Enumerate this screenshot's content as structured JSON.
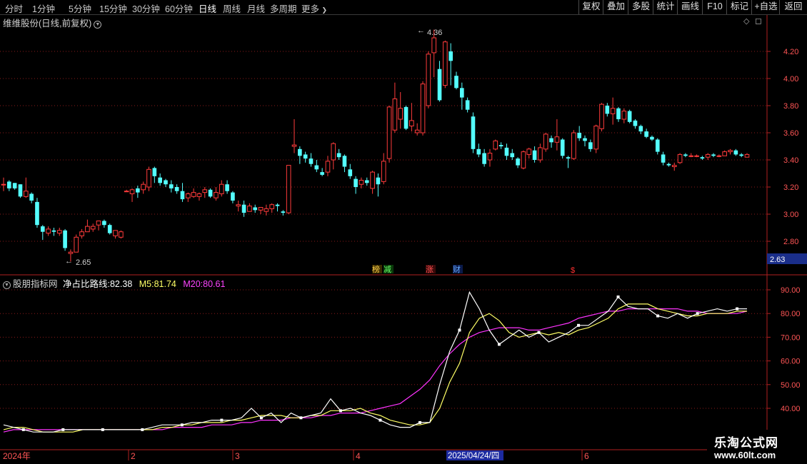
{
  "toolbar": {
    "periods": [
      "分时",
      "1分钟",
      "5分钟",
      "15分钟",
      "30分钟",
      "60分钟",
      "日线",
      "周线",
      "月线",
      "多周期",
      "更多"
    ],
    "more_glyph": "❯",
    "right_buttons": [
      "复权",
      "叠加",
      "多股",
      "统计",
      "画线",
      "F10",
      "标记",
      "+自选",
      "返回"
    ]
  },
  "main_panel": {
    "title": "维维股份(日线,前复权)",
    "y_ticks": [
      "4.20",
      "4.00",
      "3.80",
      "3.60",
      "3.40",
      "3.20",
      "3.00",
      "2.80"
    ],
    "price_tag": "2.63",
    "high_label": "4.36",
    "low_label": "2.65",
    "markers": [
      "榜",
      "减",
      "涨",
      "财",
      "$"
    ],
    "colors": {
      "up": "#ff3b3b",
      "down": "#54ffff",
      "grid": "#8a1a1a",
      "axis": "#b02020"
    }
  },
  "indicator_panel": {
    "name": "股朋指标网",
    "line_label": "净占比路线:",
    "line_value": "82.38",
    "m5_label": "M5:",
    "m5_value": "81.74",
    "m20_label": "M20:",
    "m20_value": "80.61",
    "y_ticks": [
      "90.00",
      "80.00",
      "70.00",
      "60.00",
      "50.00",
      "40.00"
    ],
    "colors": {
      "line": "#ffffff",
      "m5": "#ffff66",
      "m20": "#ff33ff"
    }
  },
  "date_axis": {
    "labels": [
      "2024年",
      "2",
      "3",
      "4",
      "6"
    ],
    "cursor_date": "2025/04/24/四"
  },
  "watermark": {
    "line1": "乐淘公式网",
    "line2": "www.60lt.com"
  },
  "chart_data": {
    "type": "candlestick",
    "candles": [
      [
        3.22,
        3.27,
        3.17,
        3.22
      ],
      [
        3.24,
        3.25,
        3.17,
        3.19
      ],
      [
        3.23,
        3.23,
        3.18,
        3.19
      ],
      [
        3.22,
        3.22,
        3.12,
        3.13
      ],
      [
        3.13,
        3.27,
        3.12,
        3.17
      ],
      [
        3.15,
        3.16,
        3.08,
        3.1
      ],
      [
        3.09,
        3.12,
        2.9,
        2.92
      ],
      [
        2.91,
        2.92,
        2.81,
        2.87
      ],
      [
        2.86,
        2.91,
        2.84,
        2.89
      ],
      [
        2.88,
        2.9,
        2.84,
        2.87
      ],
      [
        2.86,
        2.9,
        2.84,
        2.88
      ],
      [
        2.88,
        2.89,
        2.73,
        2.75
      ],
      [
        2.71,
        2.74,
        2.65,
        2.72
      ],
      [
        2.72,
        2.85,
        2.72,
        2.83
      ],
      [
        2.84,
        2.89,
        2.82,
        2.87
      ],
      [
        2.87,
        2.96,
        2.87,
        2.91
      ],
      [
        2.89,
        2.93,
        2.87,
        2.91
      ],
      [
        2.92,
        2.93,
        2.88,
        2.95
      ],
      [
        2.95,
        2.96,
        2.9,
        2.92
      ],
      [
        2.92,
        2.93,
        2.85,
        2.86
      ],
      [
        2.84,
        2.86,
        2.82,
        2.88
      ],
      [
        2.83,
        2.88,
        2.82,
        2.87
      ],
      [
        3.17,
        3.18,
        3.17,
        3.17
      ],
      [
        3.15,
        3.19,
        3.09,
        3.18
      ],
      [
        3.19,
        3.21,
        3.12,
        3.16
      ],
      [
        3.18,
        3.24,
        3.15,
        3.22
      ],
      [
        3.2,
        3.35,
        3.17,
        3.33
      ],
      [
        3.34,
        3.35,
        3.23,
        3.28
      ],
      [
        3.27,
        3.3,
        3.21,
        3.23
      ],
      [
        3.25,
        3.26,
        3.2,
        3.22
      ],
      [
        3.22,
        3.25,
        3.16,
        3.19
      ],
      [
        3.2,
        3.22,
        3.15,
        3.17
      ],
      [
        3.17,
        3.23,
        3.09,
        3.11
      ],
      [
        3.12,
        3.16,
        3.09,
        3.15
      ],
      [
        3.13,
        3.19,
        3.12,
        3.16
      ],
      [
        3.13,
        3.16,
        3.1,
        3.15
      ],
      [
        3.16,
        3.2,
        3.12,
        3.18
      ],
      [
        3.18,
        3.19,
        3.12,
        3.13
      ],
      [
        3.12,
        3.2,
        3.1,
        3.16
      ],
      [
        3.15,
        3.25,
        3.13,
        3.22
      ],
      [
        3.22,
        3.25,
        3.15,
        3.17
      ],
      [
        3.16,
        3.17,
        3.08,
        3.1
      ],
      [
        3.06,
        3.1,
        3.02,
        3.07
      ],
      [
        3.07,
        3.1,
        2.98,
        3.01
      ],
      [
        3.02,
        3.08,
        3.02,
        3.06
      ],
      [
        3.05,
        3.07,
        3.01,
        3.03
      ],
      [
        3.03,
        3.05,
        3.0,
        3.05
      ],
      [
        3.02,
        3.07,
        2.99,
        3.04
      ],
      [
        3.04,
        3.08,
        3.01,
        3.07
      ],
      [
        3.07,
        3.08,
        3.02,
        3.06
      ],
      [
        3.02,
        3.03,
        2.99,
        3.01
      ],
      [
        3.01,
        3.36,
        3.0,
        3.36
      ],
      [
        3.5,
        3.7,
        3.45,
        3.51
      ],
      [
        3.48,
        3.5,
        3.37,
        3.43
      ],
      [
        3.44,
        3.46,
        3.38,
        3.41
      ],
      [
        3.41,
        3.45,
        3.35,
        3.37
      ],
      [
        3.36,
        3.4,
        3.31,
        3.33
      ],
      [
        3.31,
        3.34,
        3.28,
        3.29
      ],
      [
        3.31,
        3.43,
        3.28,
        3.39
      ],
      [
        3.4,
        3.53,
        3.33,
        3.52
      ],
      [
        3.45,
        3.48,
        3.4,
        3.42
      ],
      [
        3.43,
        3.44,
        3.31,
        3.35
      ],
      [
        3.33,
        3.37,
        3.26,
        3.28
      ],
      [
        3.26,
        3.28,
        3.15,
        3.2
      ],
      [
        3.22,
        3.27,
        3.19,
        3.25
      ],
      [
        3.25,
        3.27,
        3.21,
        3.23
      ],
      [
        3.19,
        3.32,
        3.15,
        3.31
      ],
      [
        3.27,
        3.3,
        3.13,
        3.22
      ],
      [
        3.24,
        3.45,
        3.22,
        3.39
      ],
      [
        3.41,
        3.8,
        3.38,
        3.79
      ],
      [
        3.62,
        3.97,
        3.6,
        3.85
      ],
      [
        3.7,
        3.9,
        3.63,
        3.78
      ],
      [
        3.79,
        3.8,
        3.62,
        3.63
      ],
      [
        3.65,
        3.82,
        3.61,
        3.69
      ],
      [
        3.6,
        3.67,
        3.58,
        3.62
      ],
      [
        3.6,
        3.98,
        3.58,
        3.96
      ],
      [
        3.8,
        4.2,
        3.78,
        4.18
      ],
      [
        4.19,
        4.36,
        4.01,
        4.3
      ],
      [
        4.07,
        4.13,
        3.83,
        3.84
      ],
      [
        3.95,
        4.28,
        3.93,
        4.27
      ],
      [
        4.2,
        4.26,
        3.95,
        4.13
      ],
      [
        4.02,
        4.05,
        3.92,
        3.93
      ],
      [
        3.93,
        3.97,
        3.77,
        3.86
      ],
      [
        3.84,
        3.86,
        3.75,
        3.77
      ],
      [
        3.72,
        3.75,
        3.45,
        3.48
      ],
      [
        3.48,
        3.52,
        3.42,
        3.44
      ],
      [
        3.45,
        3.48,
        3.35,
        3.37
      ],
      [
        3.4,
        3.48,
        3.35,
        3.45
      ],
      [
        3.48,
        3.55,
        3.47,
        3.54
      ],
      [
        3.51,
        3.53,
        3.48,
        3.5
      ],
      [
        3.49,
        3.52,
        3.4,
        3.43
      ],
      [
        3.45,
        3.48,
        3.4,
        3.42
      ],
      [
        3.41,
        3.42,
        3.34,
        3.36
      ],
      [
        3.34,
        3.47,
        3.33,
        3.46
      ],
      [
        3.44,
        3.49,
        3.41,
        3.48
      ],
      [
        3.47,
        3.5,
        3.38,
        3.4
      ],
      [
        3.4,
        3.52,
        3.38,
        3.49
      ],
      [
        3.48,
        3.6,
        3.46,
        3.59
      ],
      [
        3.56,
        3.58,
        3.49,
        3.53
      ],
      [
        3.53,
        3.7,
        3.47,
        3.57
      ],
      [
        3.55,
        3.56,
        3.41,
        3.43
      ],
      [
        3.42,
        3.43,
        3.34,
        3.41
      ],
      [
        3.41,
        3.62,
        3.4,
        3.6
      ],
      [
        3.6,
        3.65,
        3.54,
        3.56
      ],
      [
        3.56,
        3.58,
        3.5,
        3.54
      ],
      [
        3.53,
        3.55,
        3.46,
        3.48
      ],
      [
        3.48,
        3.66,
        3.45,
        3.65
      ],
      [
        3.63,
        3.82,
        3.61,
        3.81
      ],
      [
        3.8,
        3.82,
        3.72,
        3.74
      ],
      [
        3.74,
        3.86,
        3.66,
        3.78
      ],
      [
        3.78,
        3.79,
        3.68,
        3.7
      ],
      [
        3.7,
        3.78,
        3.67,
        3.76
      ],
      [
        3.76,
        3.77,
        3.67,
        3.68
      ],
      [
        3.69,
        3.7,
        3.63,
        3.65
      ],
      [
        3.65,
        3.66,
        3.59,
        3.61
      ],
      [
        3.61,
        3.63,
        3.56,
        3.57
      ],
      [
        3.57,
        3.58,
        3.54,
        3.55
      ],
      [
        3.55,
        3.56,
        3.44,
        3.46
      ],
      [
        3.44,
        3.46,
        3.36,
        3.38
      ],
      [
        3.37,
        3.38,
        3.35,
        3.36
      ],
      [
        3.35,
        3.38,
        3.32,
        3.36
      ],
      [
        3.38,
        3.45,
        3.37,
        3.44
      ],
      [
        3.44,
        3.45,
        3.42,
        3.43
      ],
      [
        3.43,
        3.45,
        3.42,
        3.43
      ],
      [
        3.43,
        3.44,
        3.42,
        3.43
      ],
      [
        3.42,
        3.43,
        3.4,
        3.41
      ],
      [
        3.42,
        3.45,
        3.4,
        3.44
      ],
      [
        3.44,
        3.45,
        3.42,
        3.43
      ],
      [
        3.43,
        3.44,
        3.42,
        3.43
      ],
      [
        3.43,
        3.47,
        3.43,
        3.46
      ],
      [
        3.46,
        3.48,
        3.44,
        3.47
      ],
      [
        3.47,
        3.48,
        3.43,
        3.44
      ],
      [
        3.44,
        3.45,
        3.42,
        3.43
      ],
      [
        3.42,
        3.45,
        3.42,
        3.44
      ]
    ],
    "indicator": {
      "line": [
        33,
        32,
        31,
        30,
        30,
        30,
        31,
        31,
        31,
        31,
        31,
        31,
        31,
        31,
        31,
        32,
        33,
        33,
        33,
        34,
        34,
        35,
        35,
        35,
        36,
        40,
        36,
        38,
        34,
        38,
        36,
        37,
        38,
        44,
        39,
        40,
        38,
        37,
        35,
        33,
        32,
        32,
        34,
        34,
        50,
        64,
        73,
        89,
        82,
        73,
        67,
        70,
        73,
        70,
        72,
        68,
        70,
        72,
        75,
        75,
        78,
        81,
        87,
        83,
        82,
        82,
        79,
        78,
        80,
        78,
        80,
        81,
        82,
        81,
        82,
        82
      ],
      "m5": [
        31,
        32,
        32,
        31,
        30,
        30,
        30,
        30,
        31,
        31,
        31,
        31,
        31,
        31,
        31,
        31,
        32,
        32,
        33,
        33,
        34,
        34,
        34,
        35,
        35,
        36,
        37,
        37,
        37,
        36,
        36,
        37,
        37,
        39,
        39,
        39,
        40,
        38,
        37,
        35,
        34,
        33,
        33,
        34,
        40,
        51,
        59,
        72,
        78,
        80,
        77,
        72,
        70,
        71,
        72,
        71,
        72,
        71,
        73,
        74,
        76,
        78,
        82,
        84,
        84,
        84,
        82,
        81,
        80,
        79,
        79,
        80,
        80,
        80,
        81,
        81
      ],
      "m20": [
        30,
        31,
        31,
        31,
        31,
        31,
        31,
        31,
        31,
        31,
        31,
        31,
        31,
        31,
        31,
        31,
        31,
        32,
        32,
        32,
        32,
        33,
        33,
        33,
        34,
        34,
        35,
        35,
        35,
        36,
        36,
        36,
        37,
        37,
        38,
        38,
        38,
        39,
        40,
        41,
        42,
        45,
        48,
        52,
        58,
        63,
        67,
        70,
        72,
        73,
        74,
        74,
        74,
        73,
        73,
        74,
        75,
        76,
        78,
        79,
        80,
        81,
        81,
        82,
        82,
        82,
        82,
        82,
        82,
        81,
        81,
        80,
        80,
        80,
        80,
        81
      ]
    }
  }
}
